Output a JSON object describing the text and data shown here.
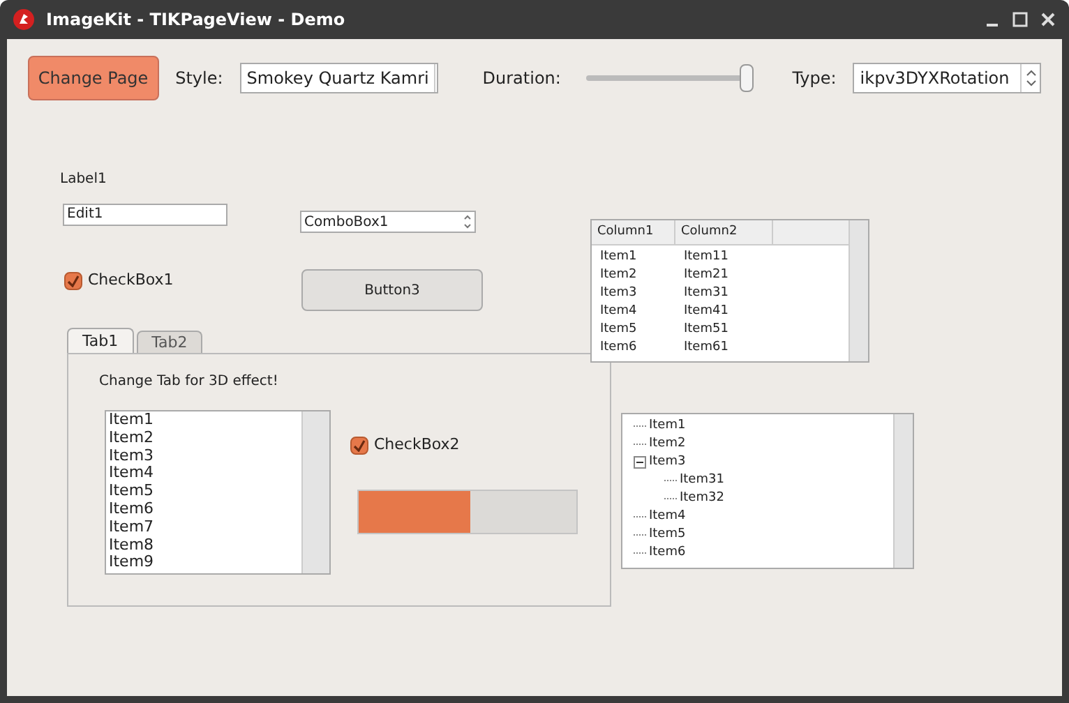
{
  "window": {
    "title": "ImageKit - TIKPageView - Demo"
  },
  "toolbar": {
    "button": "Change Page",
    "style_label": "Style:",
    "style_value": "Smokey Quartz Kamri",
    "duration": {
      "label": "Duration:",
      "level": 0.95
    },
    "type_label": "Type:",
    "type_value": "ikpv3DYXRotation"
  },
  "page": {
    "label": "Label1",
    "edit": "Edit1",
    "combo": "ComboBox1",
    "checkbox1": {
      "label": "CheckBox1",
      "checked": true
    },
    "button": "Button3",
    "tabs": [
      {
        "label": "Tab1",
        "selected": true
      },
      {
        "label": "Tab2",
        "selected": false
      }
    ],
    "tab_content": {
      "caption": "Change Tab for 3D effect!",
      "listbox": [
        "Item1",
        "Item2",
        "Item3",
        "Item4",
        "Item5",
        "Item6",
        "Item7",
        "Item8",
        "Item9"
      ],
      "checkbox2": {
        "label": "CheckBox2",
        "checked": true
      },
      "progress": {
        "level": 0.51
      }
    },
    "listview": {
      "columns": [
        "Column1",
        "Column2"
      ],
      "rows": [
        [
          "Item1",
          "Item11"
        ],
        [
          "Item2",
          "Item21"
        ],
        [
          "Item3",
          "Item31"
        ],
        [
          "Item4",
          "Item41"
        ],
        [
          "Item5",
          "Item51"
        ],
        [
          "Item6",
          "Item61"
        ]
      ]
    },
    "tree": [
      {
        "label": "Item1"
      },
      {
        "label": "Item2"
      },
      {
        "label": "Item3",
        "expanded": true,
        "children": [
          {
            "label": "Item31"
          },
          {
            "label": "Item32"
          }
        ]
      },
      {
        "label": "Item4"
      },
      {
        "label": "Item5"
      },
      {
        "label": "Item6"
      }
    ]
  }
}
